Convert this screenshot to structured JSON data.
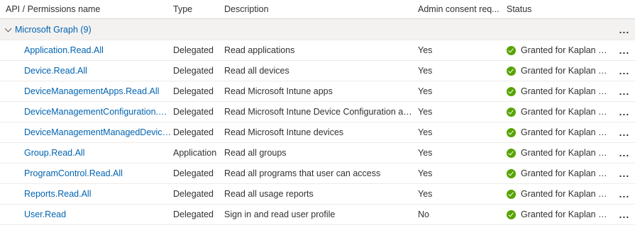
{
  "headers": {
    "name": "API / Permissions name",
    "type": "Type",
    "description": "Description",
    "admin_consent": "Admin consent req...",
    "status": "Status"
  },
  "group": {
    "label": "Microsoft Graph (9)",
    "more": "..."
  },
  "rows": [
    {
      "name": "Application.Read.All",
      "type": "Delegated",
      "description": "Read applications",
      "admin": "Yes",
      "status": "Granted for Kaplan Inter...",
      "more": "..."
    },
    {
      "name": "Device.Read.All",
      "type": "Delegated",
      "description": "Read all devices",
      "admin": "Yes",
      "status": "Granted for Kaplan Inter...",
      "more": "..."
    },
    {
      "name": "DeviceManagementApps.Read.All",
      "type": "Delegated",
      "description": "Read Microsoft Intune apps",
      "admin": "Yes",
      "status": "Granted for Kaplan Inter...",
      "more": "..."
    },
    {
      "name": "DeviceManagementConfiguration.Read.All",
      "type": "Delegated",
      "description": "Read Microsoft Intune Device Configuration and ...",
      "admin": "Yes",
      "status": "Granted for Kaplan Inter...",
      "more": "..."
    },
    {
      "name": "DeviceManagementManagedDevices.Reac",
      "type": "Delegated",
      "description": "Read Microsoft Intune devices",
      "admin": "Yes",
      "status": "Granted for Kaplan Inter...",
      "more": "..."
    },
    {
      "name": "Group.Read.All",
      "type": "Application",
      "description": "Read all groups",
      "admin": "Yes",
      "status": "Granted for Kaplan Inter...",
      "more": "..."
    },
    {
      "name": "ProgramControl.Read.All",
      "type": "Delegated",
      "description": "Read all programs that user can access",
      "admin": "Yes",
      "status": "Granted for Kaplan Inter...",
      "more": "..."
    },
    {
      "name": "Reports.Read.All",
      "type": "Delegated",
      "description": "Read all usage reports",
      "admin": "Yes",
      "status": "Granted for Kaplan Inter...",
      "more": "..."
    },
    {
      "name": "User.Read",
      "type": "Delegated",
      "description": "Sign in and read user profile",
      "admin": "No",
      "status": "Granted for Kaplan Inter...",
      "more": "..."
    }
  ],
  "colors": {
    "link": "#0063b1",
    "granted": "#57a300",
    "group_bg": "#f3f2f1"
  },
  "icons": {
    "status": "check-circle-icon",
    "group_toggle": "chevron-down-icon",
    "row_menu": "more-horizontal-icon"
  }
}
